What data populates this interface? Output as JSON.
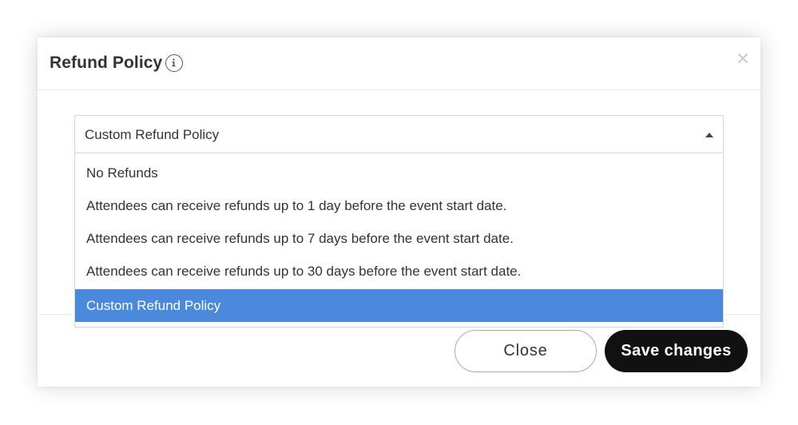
{
  "modal": {
    "title": "Refund Policy",
    "info_icon": "info-icon",
    "close_icon": "close-icon"
  },
  "refund_select": {
    "value": "Custom Refund Policy",
    "caret_icon": "caret-up-icon",
    "options": [
      {
        "label": "No Refunds",
        "selected": false
      },
      {
        "label": "Attendees can receive refunds up to 1 day before the event start date.",
        "selected": false
      },
      {
        "label": "Attendees can receive refunds up to 7 days before the event start date.",
        "selected": false
      },
      {
        "label": "Attendees can receive refunds up to 30 days before the event start date.",
        "selected": false
      },
      {
        "label": "Custom Refund Policy",
        "selected": true
      }
    ]
  },
  "footer": {
    "close_label": "Close",
    "save_label": "Save changes"
  },
  "colors": {
    "selected_option_bg": "#4a89dc",
    "primary_button_bg": "#111111",
    "text": "#333333"
  }
}
